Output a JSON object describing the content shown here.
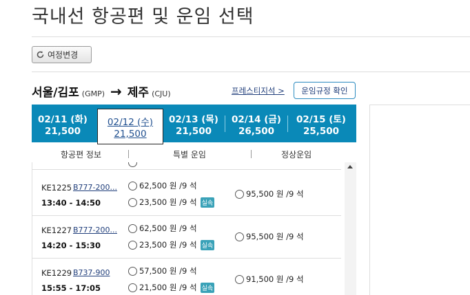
{
  "page": {
    "title": "국내선 항공편 및 운임 선택",
    "change_itinerary_label": "여정변경"
  },
  "route": {
    "origin_city": "서울/김포",
    "origin_code": "(GMP)",
    "arrow": "→",
    "dest_city": "제주",
    "dest_code": "(CJU)",
    "prestige_link": "프레스티지석 >",
    "fare_rules_label": "운임규정 확인"
  },
  "dates": [
    {
      "date": "02/11 (화)",
      "price": "21,500",
      "selected": false
    },
    {
      "date": "02/12 (수)",
      "price": "21,500",
      "selected": true
    },
    {
      "date": "02/13 (목)",
      "price": "21,500",
      "selected": false
    },
    {
      "date": "02/14 (금)",
      "price": "26,500",
      "selected": false
    },
    {
      "date": "02/15 (토)",
      "price": "25,500",
      "selected": false
    }
  ],
  "columns": {
    "flight_info": "항공편 정보",
    "special_fare": "특별 운임",
    "normal_fare": "정상운임"
  },
  "badge_label": "실속",
  "flights": [
    {
      "flight_no": "KE1225",
      "aircraft": "B777-200...",
      "time": "13:40 - 14:50",
      "special_1": "62,500 원  /9 석",
      "special_2": "23,500 원  /9 석",
      "normal": "95,500 원  /9 석"
    },
    {
      "flight_no": "KE1227",
      "aircraft": "B777-200...",
      "time": "14:20 - 15:30",
      "special_1": "62,500 원  /9 석",
      "special_2": "23,500 원  /9 석",
      "normal": "95,500 원  /9 석"
    },
    {
      "flight_no": "KE1229",
      "aircraft": "B737-900",
      "time": "15:55 - 17:05",
      "special_1": "57,500 원  /9 석",
      "special_2": "21,500 원  /9 석",
      "normal": "91,500 원  /9 석"
    }
  ],
  "colors": {
    "date_bar": "#0a89b8",
    "badge": "#3aa2b8",
    "link": "#1f3d7a"
  }
}
